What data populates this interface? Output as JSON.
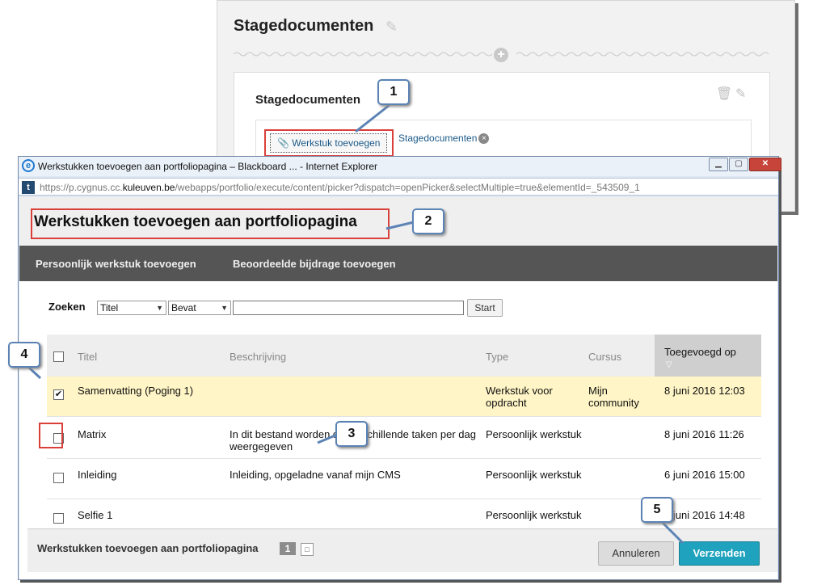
{
  "background_page": {
    "section_title": "Stagedocumenten",
    "card_title": "Stagedocumenten",
    "add_artifact_label": "Werkstuk toevoegen",
    "tag_label": "Stagedocumenten"
  },
  "browser": {
    "window_title": "Werkstukken toevoegen aan portfoliopagina – Blackboard ... - Internet Explorer",
    "url_prefix": "https://p.cygnus.cc.",
    "url_domain": "kuleuven.be",
    "url_path": "/webapps/portfolio/execute/content/picker?dispatch=openPicker&selectMultiple=true&elementId=_543509_1",
    "site_icon_letter": "t"
  },
  "page": {
    "title": "Werkstukken toevoegen aan portfoliopagina",
    "actions": [
      "Persoonlijk werkstuk toevoegen",
      "Beoordeelde bijdrage toevoegen"
    ],
    "search": {
      "label": "Zoeken",
      "field_value": "Titel",
      "operator_value": "Bevat",
      "query_value": "",
      "button_label": "Start"
    },
    "table": {
      "headers": {
        "title": "Titel",
        "description": "Beschrijving",
        "type": "Type",
        "course": "Cursus",
        "added": "Toegevoegd op"
      },
      "rows": [
        {
          "checked": true,
          "title": "Samenvatting (Poging 1)",
          "description": "",
          "type": "Werkstuk voor opdracht",
          "course": "Mijn community",
          "added": "8 juni 2016 12:03"
        },
        {
          "checked": false,
          "title": "Matrix",
          "description": "In dit bestand worden de verschillende taken per dag weergegeven",
          "type": "Persoonlijk werkstuk",
          "course": "",
          "added": "8 juni 2016 11:26"
        },
        {
          "checked": false,
          "title": "Inleiding",
          "description": "Inleiding, opgeladne vanaf mijn CMS",
          "type": "Persoonlijk werkstuk",
          "course": "",
          "added": "6 juni 2016 15:00"
        },
        {
          "checked": false,
          "title": "Selfie 1",
          "description": "",
          "type": "Persoonlijk werkstuk",
          "course": "",
          "added": "8 juni 2016 14:48"
        }
      ]
    },
    "footer": {
      "title": "Werkstukken toevoegen aan portfoliopagina",
      "count": "1",
      "cancel_label": "Annuleren",
      "submit_label": "Verzenden"
    }
  },
  "callouts": [
    "1",
    "2",
    "3",
    "4",
    "5"
  ],
  "colors": {
    "highlight_red": "#d9403a",
    "submit_teal": "#1ea2bd",
    "action_bar": "#555555",
    "selected_row": "#fff5c6",
    "callout_border": "#5b83b5"
  }
}
